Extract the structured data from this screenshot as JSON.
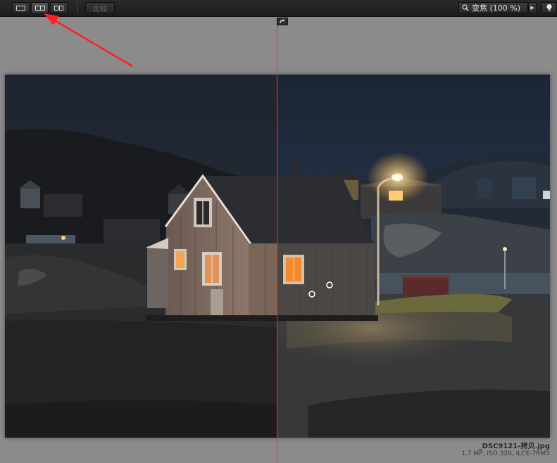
{
  "toolbar": {
    "view_buttons": [
      {
        "name": "single-view",
        "icon": "single-pane-icon"
      },
      {
        "name": "split-view",
        "icon": "split-pane-icon",
        "active": true
      },
      {
        "name": "side-by-side-view",
        "icon": "side-by-side-icon"
      }
    ],
    "compare_label": "比较",
    "zoom_label": "变焦 (100 %)",
    "zoom_icon": "magnifier-icon",
    "last_icon": "lightbulb-icon"
  },
  "image": {
    "file_name": "_DSC9121-拷贝.jpg",
    "meta": "1.7 MP, ISO 320, ILCE-7RM3"
  },
  "colors": {
    "split_line": "#ff2a2a",
    "annotation_arrow": "#ff2020",
    "toolbar_bg": "#222222",
    "workspace_bg": "#8b8b8b"
  }
}
